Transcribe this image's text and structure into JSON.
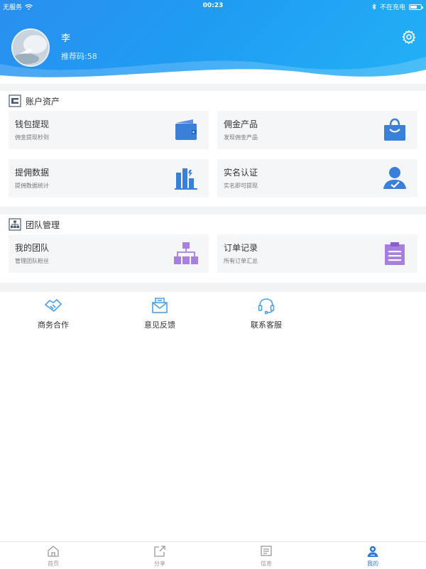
{
  "status_bar": {
    "carrier": "无服务",
    "time": "00:23",
    "charging": "不在充电"
  },
  "profile": {
    "name": "李",
    "referral": "推荐码:58"
  },
  "sections": [
    {
      "title": "账户资产",
      "cards": [
        {
          "title": "钱包提现",
          "subtitle": "佣金提现秒到",
          "icon": "wallet-icon"
        },
        {
          "title": "佣金产品",
          "subtitle": "发现佣金产品",
          "icon": "shopping-bag-icon"
        },
        {
          "title": "提佣数据",
          "subtitle": "提佣数据统计",
          "icon": "bar-chart-icon"
        },
        {
          "title": "实名认证",
          "subtitle": "实名即可提现",
          "icon": "user-verified-icon"
        }
      ]
    },
    {
      "title": "团队管理",
      "cards": [
        {
          "title": "我的团队",
          "subtitle": "管理团队粉丝",
          "icon": "org-chart-icon"
        },
        {
          "title": "订单记录",
          "subtitle": "所有订单汇总",
          "icon": "clipboard-icon"
        }
      ]
    }
  ],
  "quick_links": [
    {
      "label": "商务合作",
      "icon": "handshake-icon"
    },
    {
      "label": "意见反馈",
      "icon": "feedback-mail-icon"
    },
    {
      "label": "联系客服",
      "icon": "headset-icon"
    }
  ],
  "tabs": [
    {
      "label": "首页",
      "icon": "home-icon",
      "active": false
    },
    {
      "label": "分享",
      "icon": "share-icon",
      "active": false
    },
    {
      "label": "信息",
      "icon": "message-icon",
      "active": false
    },
    {
      "label": "我的",
      "icon": "profile-icon",
      "active": true
    }
  ],
  "colors": {
    "header_start": "#2a8ff0",
    "header_end": "#23b1f6",
    "icon_blue": "#3a7fd8",
    "icon_purple": "#a77fe0",
    "active_tab": "#2f7ad6"
  }
}
